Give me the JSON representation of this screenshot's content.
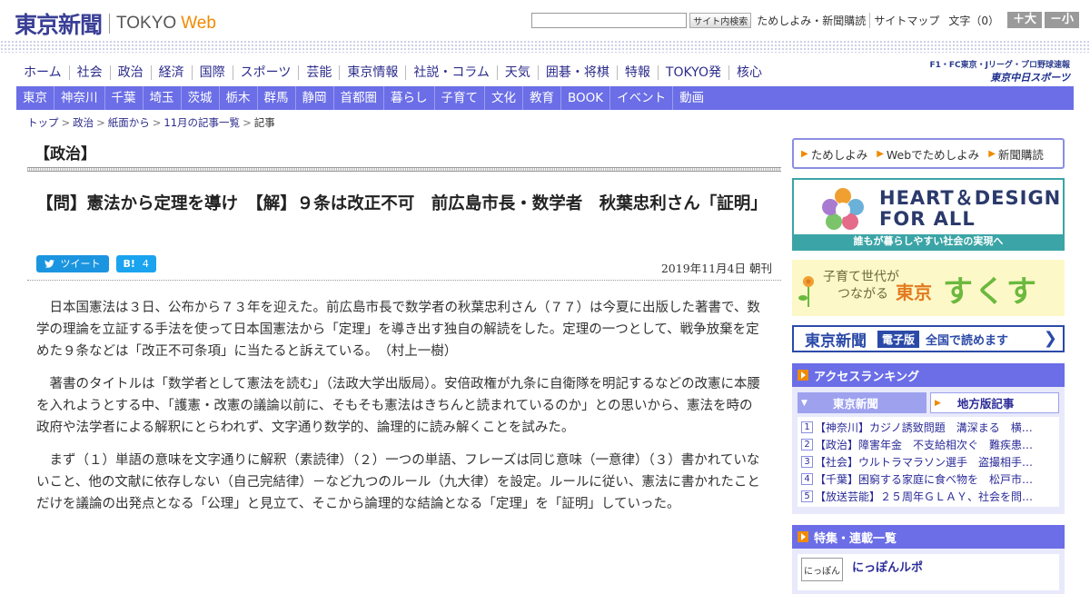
{
  "header": {
    "logo_jp": "東京新聞",
    "logo_en_1": "TOKYO",
    "logo_en_2": "Web",
    "search": {
      "placeholder": "",
      "button_label": "サイト内検索"
    },
    "links": [
      "ためしよみ・新聞購読",
      "サイトマップ"
    ],
    "font_size_label": "文字（0）",
    "font_larger": "＋大",
    "font_smaller": "－小"
  },
  "main_nav": [
    "ホーム",
    "社会",
    "政治",
    "経済",
    "国際",
    "スポーツ",
    "芸能",
    "東京情報",
    "社説・コラム",
    "天気",
    "囲碁・将棋",
    "特報",
    "TOKYO発",
    "核心"
  ],
  "sports_banner": {
    "line1": "F1・FC東京・Jリーグ・プロ野球速報",
    "line2": "東京中日スポーツ"
  },
  "region_nav": [
    "東京",
    "神奈川",
    "千葉",
    "埼玉",
    "茨城",
    "栃木",
    "群馬",
    "静岡",
    "首都圏",
    "暮らし",
    "子育て",
    "文化",
    "教育",
    "BOOK",
    "イベント",
    "動画"
  ],
  "breadcrumb": [
    "トップ",
    "政治",
    "紙面から",
    "11月の記事一覧",
    "記事"
  ],
  "article": {
    "section": "【政治】",
    "headline": "【問】憲法から定理を導け　【解】９条は改正不可　前広島市長・数学者　秋葉忠利さん「証明」",
    "tweet_label": "ツイート",
    "hatena_label": "B!",
    "hatena_count": "4",
    "date": "2019年11月4日 朝刊",
    "paragraphs": [
      "日本国憲法は３日、公布から７３年を迎えた。前広島市長で数学者の秋葉忠利さん（７７）は今夏に出版した著書で、数学の理論を立証する手法を使って日本国憲法から「定理」を導き出す独自の解読をした。定理の一つとして、戦争放棄を定めた９条などは「改正不可条項」に当たると訴えている。　（村上一樹）",
      "著書のタイトルは「数学者として憲法を読む」（法政大学出版局）。安倍政権が九条に自衛隊を明記するなどの改憲に本腰を入れようとする中、「護憲・改憲の議論以前に、そもそも憲法はきちんと読まれているのか」との思いから、憲法を時の政府や法学者による解釈にとらわれず、文字通り数学的、論理的に読み解くことを試みた。",
      "まず（１）単語の意味を文字通りに解釈（素読律）（２）一つの単語、フレーズは同じ意味（一意律）（３）書かれていないこと、他の文献に依存しない（自己完結律）－など九つのルール（九大律）を設定。ルールに従い、憲法に書かれたことだけを議論の出発点となる「公理」と見立て、そこから論理的な結論となる「定理」を「証明」していった。"
    ]
  },
  "sidebar": {
    "sub_links": [
      "ためしよみ",
      "Webでためしよみ",
      "新聞購読"
    ],
    "heart_banner": {
      "line1": "HEART＆DESIGN",
      "line2": "FOR ALL",
      "caption": "誰もが暮らしやすい社会の実現へ"
    },
    "sukusuku_banner": {
      "line1": "子育て世代が",
      "line2": "つながる",
      "tokyo": "東京",
      "brand": "すくすく"
    },
    "epaper_banner": {
      "newspaper": "東京新聞",
      "edition": "電子版",
      "read": "全国で読めます"
    },
    "ranking": {
      "title": "アクセスランキング",
      "tab_tokyo": "東京新聞",
      "tab_local": "地方版記事",
      "items": [
        {
          "num": "1",
          "text": "【神奈川】カジノ誘致問題　溝深まる　横…"
        },
        {
          "num": "2",
          "text": "【政治】障害年金　不支給相次ぐ　難疾患…"
        },
        {
          "num": "3",
          "text": "【社会】ウルトラマラソン選手　盗撮相手…"
        },
        {
          "num": "4",
          "text": "【千葉】困窮する家庭に食べ物を　松戸市…"
        },
        {
          "num": "5",
          "text": "【放送芸能】２５周年ＧＬＡＹ、社会を問…"
        }
      ]
    },
    "features": {
      "title": "特集・連載一覧",
      "item_title": "にっぽんルポ",
      "thumb_text": "にっぽん"
    }
  },
  "colors": {
    "brand_navy": "#3a3f96",
    "nav_purple": "#6b6ee6",
    "accent_orange": "#f08a00",
    "twitter_blue": "#1b95e0"
  }
}
